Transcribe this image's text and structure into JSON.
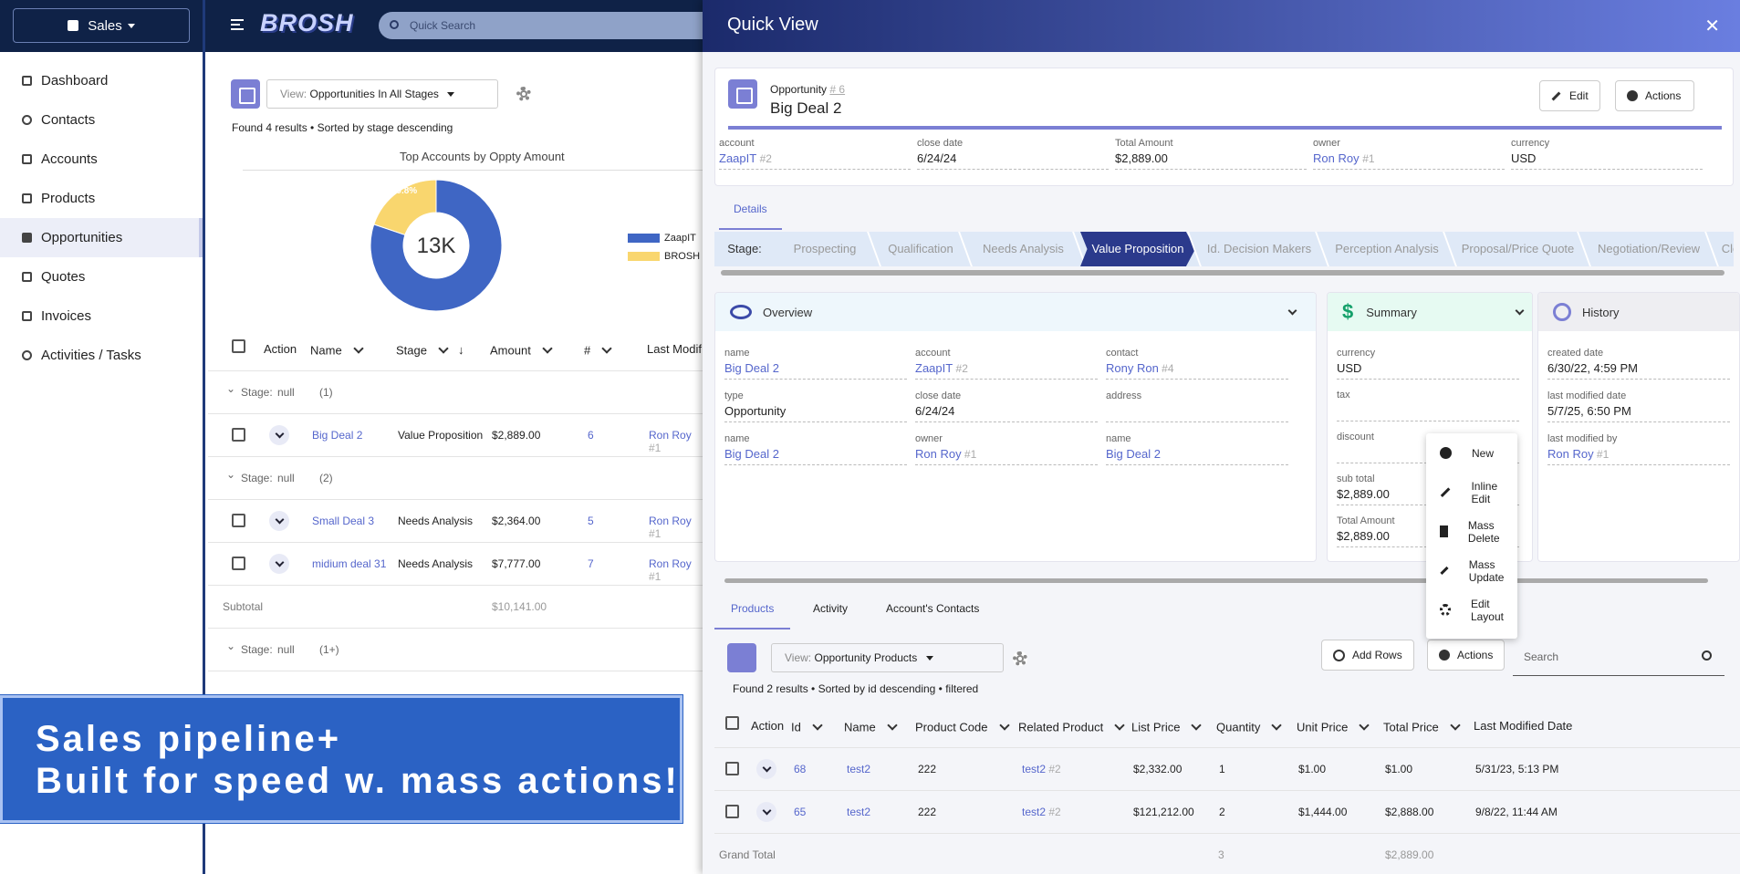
{
  "sidebar": {
    "app_name": "Sales",
    "items": [
      {
        "label": "Dashboard"
      },
      {
        "label": "Contacts"
      },
      {
        "label": "Accounts"
      },
      {
        "label": "Products"
      },
      {
        "label": "Opportunities"
      },
      {
        "label": "Quotes"
      },
      {
        "label": "Invoices"
      },
      {
        "label": "Activities / Tasks"
      }
    ]
  },
  "header": {
    "logo": "BROSH",
    "search_placeholder": "Quick Search"
  },
  "list": {
    "view_label": "View:",
    "view_value": "Opportunities In All Stages",
    "results": "Found 4 results • Sorted by stage descending",
    "columns": [
      "Action",
      "Name",
      "Stage",
      "Amount",
      "#",
      "Last Modif"
    ],
    "group1": {
      "label": "Stage:",
      "value": "null",
      "count": "(1)"
    },
    "group2": {
      "label": "Stage:",
      "value": "null",
      "count": "(2)"
    },
    "group3": {
      "label": "Stage:",
      "value": "null",
      "count": "(1+)"
    },
    "rows": [
      {
        "name": "Big Deal 2",
        "stage": "Value Proposition",
        "amount": "$2,889.00",
        "num": "6",
        "owner": "Ron Roy",
        "owner_id": "#1"
      },
      {
        "name": "Small Deal 3",
        "stage": "Needs Analysis",
        "amount": "$2,364.00",
        "num": "5",
        "owner": "Ron Roy",
        "owner_id": "#1"
      },
      {
        "name": "midium deal 31",
        "stage": "Needs Analysis",
        "amount": "$7,777.00",
        "num": "7",
        "owner": "Ron Roy",
        "owner_id": "#1"
      }
    ],
    "subtotal_label": "Subtotal",
    "subtotal_value": "$10,141.00"
  },
  "chart_data": {
    "type": "pie",
    "title": "Top Accounts by Oppty Amount",
    "center_label": "13K",
    "slices": [
      {
        "name": "ZaapIT",
        "value": 80.2,
        "label": "80.2%",
        "color": "#3f66c4"
      },
      {
        "name": "BROSH",
        "value": 19.8,
        "label": "19.8%",
        "color": "#f9d66e"
      }
    ],
    "legend_position": "right"
  },
  "banner": {
    "line1": "Sales pipeline+",
    "line2": "Built for speed w. mass actions!"
  },
  "quickview": {
    "title": "Quick View",
    "close": "✕",
    "record_type": "Opportunity",
    "record_id": "# 6",
    "record_name": "Big Deal 2",
    "edit_label": "Edit",
    "actions_label": "Actions",
    "fields": [
      {
        "label": "account",
        "value": "ZaapIT",
        "id": "#2",
        "link": true
      },
      {
        "label": "close date",
        "value": "6/24/24",
        "id": "",
        "link": false
      },
      {
        "label": "Total Amount",
        "value": "$2,889.00",
        "id": "",
        "link": false
      },
      {
        "label": "owner",
        "value": "Ron Roy",
        "id": "#1",
        "link": true
      },
      {
        "label": "currency",
        "value": "USD",
        "id": "",
        "link": false
      }
    ],
    "details_tab": "Details",
    "stage_label": "Stage:",
    "stages": [
      "Prospecting",
      "Qualification",
      "Needs Analysis",
      "Value Proposition",
      "Id. Decision Makers",
      "Perception Analysis",
      "Proposal/Price Quote",
      "Negotiation/Review",
      "Closed"
    ],
    "current_stage": "Value Proposition",
    "overview": {
      "title": "Overview",
      "fields": [
        {
          "label": "name",
          "value": "Big Deal 2",
          "id": ""
        },
        {
          "label": "account",
          "value": "ZaapIT",
          "id": "#2"
        },
        {
          "label": "contact",
          "value": "Rony Ron",
          "id": "#4"
        },
        {
          "label": "type",
          "value": "Opportunity",
          "id": ""
        },
        {
          "label": "close date",
          "value": "6/24/24",
          "id": ""
        },
        {
          "label": "address",
          "value": "",
          "id": ""
        },
        {
          "label": "name",
          "value": "Big Deal 2",
          "id": ""
        },
        {
          "label": "owner",
          "value": "Ron Roy",
          "id": "#1"
        },
        {
          "label": "name",
          "value": "Big Deal 2",
          "id": ""
        }
      ]
    },
    "summary": {
      "title": "Summary",
      "fields": [
        {
          "label": "currency",
          "value": "USD"
        },
        {
          "label": "tax",
          "value": ""
        },
        {
          "label": "discount",
          "value": ""
        },
        {
          "label": "sub total",
          "value": "$2,889.00"
        },
        {
          "label": "Total Amount",
          "value": "$2,889.00"
        }
      ]
    },
    "history": {
      "title": "History",
      "fields": [
        {
          "label": "created date",
          "value": "6/30/22, 4:59 PM",
          "id": ""
        },
        {
          "label": "last modified date",
          "value": "5/7/25, 6:50 PM",
          "id": ""
        },
        {
          "label": "last modified by",
          "value": "Ron Roy",
          "id": "#1"
        }
      ]
    },
    "tabs": [
      "Products",
      "Activity",
      "Account's Contacts"
    ],
    "products": {
      "view_label": "View:",
      "view_value": "Opportunity Products",
      "results": "Found 2 results • Sorted by id descending • filtered",
      "add_rows": "Add Rows",
      "actions": "Actions",
      "search_placeholder": "Search",
      "columns": [
        "Action",
        "Id",
        "Name",
        "Product Code",
        "Related Product",
        "List Price",
        "Quantity",
        "Unit Price",
        "Total Price",
        "Last Modified Date"
      ],
      "rows": [
        {
          "id": "68",
          "name": "test2",
          "code": "222",
          "related": "test2",
          "related_id": "#2",
          "list_price": "$2,332.00",
          "qty": "1",
          "unit": "$1.00",
          "total": "$1.00",
          "modified": "5/31/23, 5:13 PM"
        },
        {
          "id": "65",
          "name": "test2",
          "code": "222",
          "related": "test2",
          "related_id": "#2",
          "list_price": "$121,212.00",
          "qty": "2",
          "unit": "$1,444.00",
          "total": "$2,888.00",
          "modified": "9/8/22, 11:44 AM"
        }
      ],
      "grand_total_label": "Grand Total",
      "grand_total_qty": "3",
      "grand_total_price": "$2,889.00"
    },
    "menu": [
      "New",
      "Inline Edit",
      "Mass Delete",
      "Mass Update",
      "Edit Layout"
    ]
  }
}
